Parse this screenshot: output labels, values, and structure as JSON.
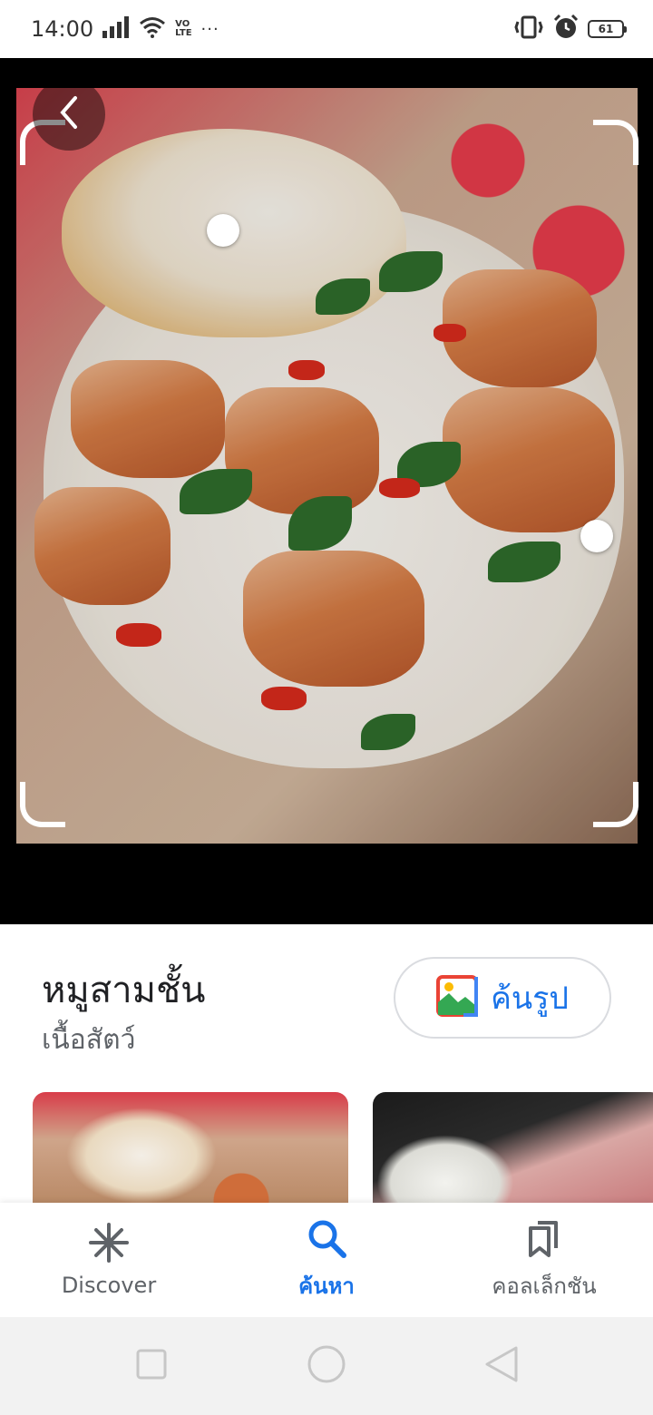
{
  "status_bar": {
    "time": "14:00",
    "network_label_top": "VO",
    "network_label_bottom": "LTE",
    "more": "···",
    "battery": "61"
  },
  "viewer": {
    "back_icon": "chevron-left-icon"
  },
  "result": {
    "title": "หมูสามชั้น",
    "category": "เนื้อสัตว์",
    "search_image_label": "ค้นรูป"
  },
  "bottom_nav": {
    "items": [
      {
        "label": "Discover",
        "icon": "asterisk-icon",
        "active": false
      },
      {
        "label": "ค้นหา",
        "icon": "search-icon",
        "active": true
      },
      {
        "label": "คอลเล็กชัน",
        "icon": "bookmarks-icon",
        "active": false
      }
    ]
  },
  "colors": {
    "accent": "#1a73e8",
    "text_primary": "#202124",
    "text_secondary": "#5f6368"
  }
}
